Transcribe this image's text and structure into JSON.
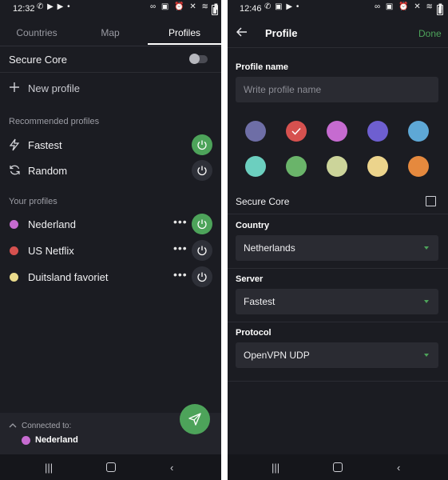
{
  "left": {
    "status": {
      "time": "12:32"
    },
    "tabs": [
      "Countries",
      "Map",
      "Profiles"
    ],
    "secure_core_label": "Secure Core",
    "new_profile": "New profile",
    "recommended_label": "Recommended profiles",
    "recommended": [
      {
        "label": "Fastest",
        "power_on": true
      },
      {
        "label": "Random",
        "power_on": false
      }
    ],
    "your_profiles_label": "Your profiles",
    "profiles": [
      {
        "label": "Nederland",
        "color": "#c66bd0",
        "power_on": true
      },
      {
        "label": "US Netflix",
        "color": "#d6514f",
        "power_on": false
      },
      {
        "label": "Duitsland favoriet",
        "color": "#eadb8c",
        "power_on": false
      }
    ],
    "connected_label": "Connected to:",
    "connected_profile": "Nederland",
    "connected_color": "#c66bd0"
  },
  "right": {
    "status": {
      "time": "12:46"
    },
    "title": "Profile",
    "done": "Done",
    "profile_name_label": "Profile name",
    "profile_name_placeholder": "Write profile name",
    "colors": [
      "#6e6ea6",
      "#d6514f",
      "#c66bd0",
      "#6e5fd0",
      "#5ea8d6",
      "#6ccfbf",
      "#6ab46a",
      "#ccd49a",
      "#ecd48c",
      "#e5893e"
    ],
    "selected_color_index": 1,
    "secure_core_label": "Secure Core",
    "country_label": "Country",
    "country_value": "Netherlands",
    "server_label": "Server",
    "server_value": "Fastest",
    "protocol_label": "Protocol",
    "protocol_value": "OpenVPN UDP"
  }
}
